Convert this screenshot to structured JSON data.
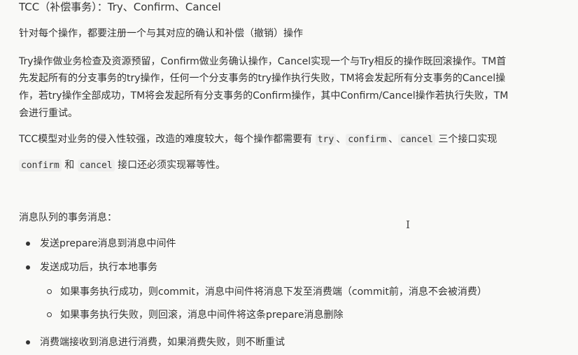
{
  "heading": "TCC（补偿事务）：Try、Confirm、Cancel",
  "intro": "针对每个操作，都要注册一个与其对应的确认和补偿（撤销）操作",
  "paragraph1_lines": [
    "Try操作做业务检查及资源预留，Confirm做业务确认操作，Cancel实现一个与Try相反的操作既回滚操作。TM首",
    "先发起所有的分支事务的try操作，任何一个分支事务的try操作执行失败，TM将会发起所有分支事务的Cancel操",
    "作，若try操作全部成功，TM将会发起所有分支事务的Confirm操作，其中Confirm/Cancel操作若执行失败，TM",
    "会进行重试。"
  ],
  "paragraph2": {
    "text_a": "TCC模型对业务的侵入性较强，改造的难度较大，每个操作都需要有 ",
    "code_try": "try",
    "sep1": "、",
    "code_confirm": "confirm",
    "sep2": "、",
    "code_cancel": "cancel",
    "text_b": " 三个接口实现"
  },
  "paragraph3": {
    "code_confirm": "confirm",
    "text_and": " 和 ",
    "code_cancel": "cancel",
    "text_c": " 接口还必须实现幂等性。"
  },
  "mq_heading": "消息队列的事务消息：",
  "mq_items": [
    "发送prepare消息到消息中间件",
    "发送成功后，执行本地事务"
  ],
  "mq_subitems": [
    "如果事务执行成功，则commit，消息中间件将消息下发至消费端（commit前，消息不会被消费）",
    "如果事务执行失败，则回滚，消息中间件将这条prepare消息删除"
  ],
  "mq_last_item": "消费端接收到消息进行消费，如果消费失败，则不断重试",
  "cursor": "I"
}
